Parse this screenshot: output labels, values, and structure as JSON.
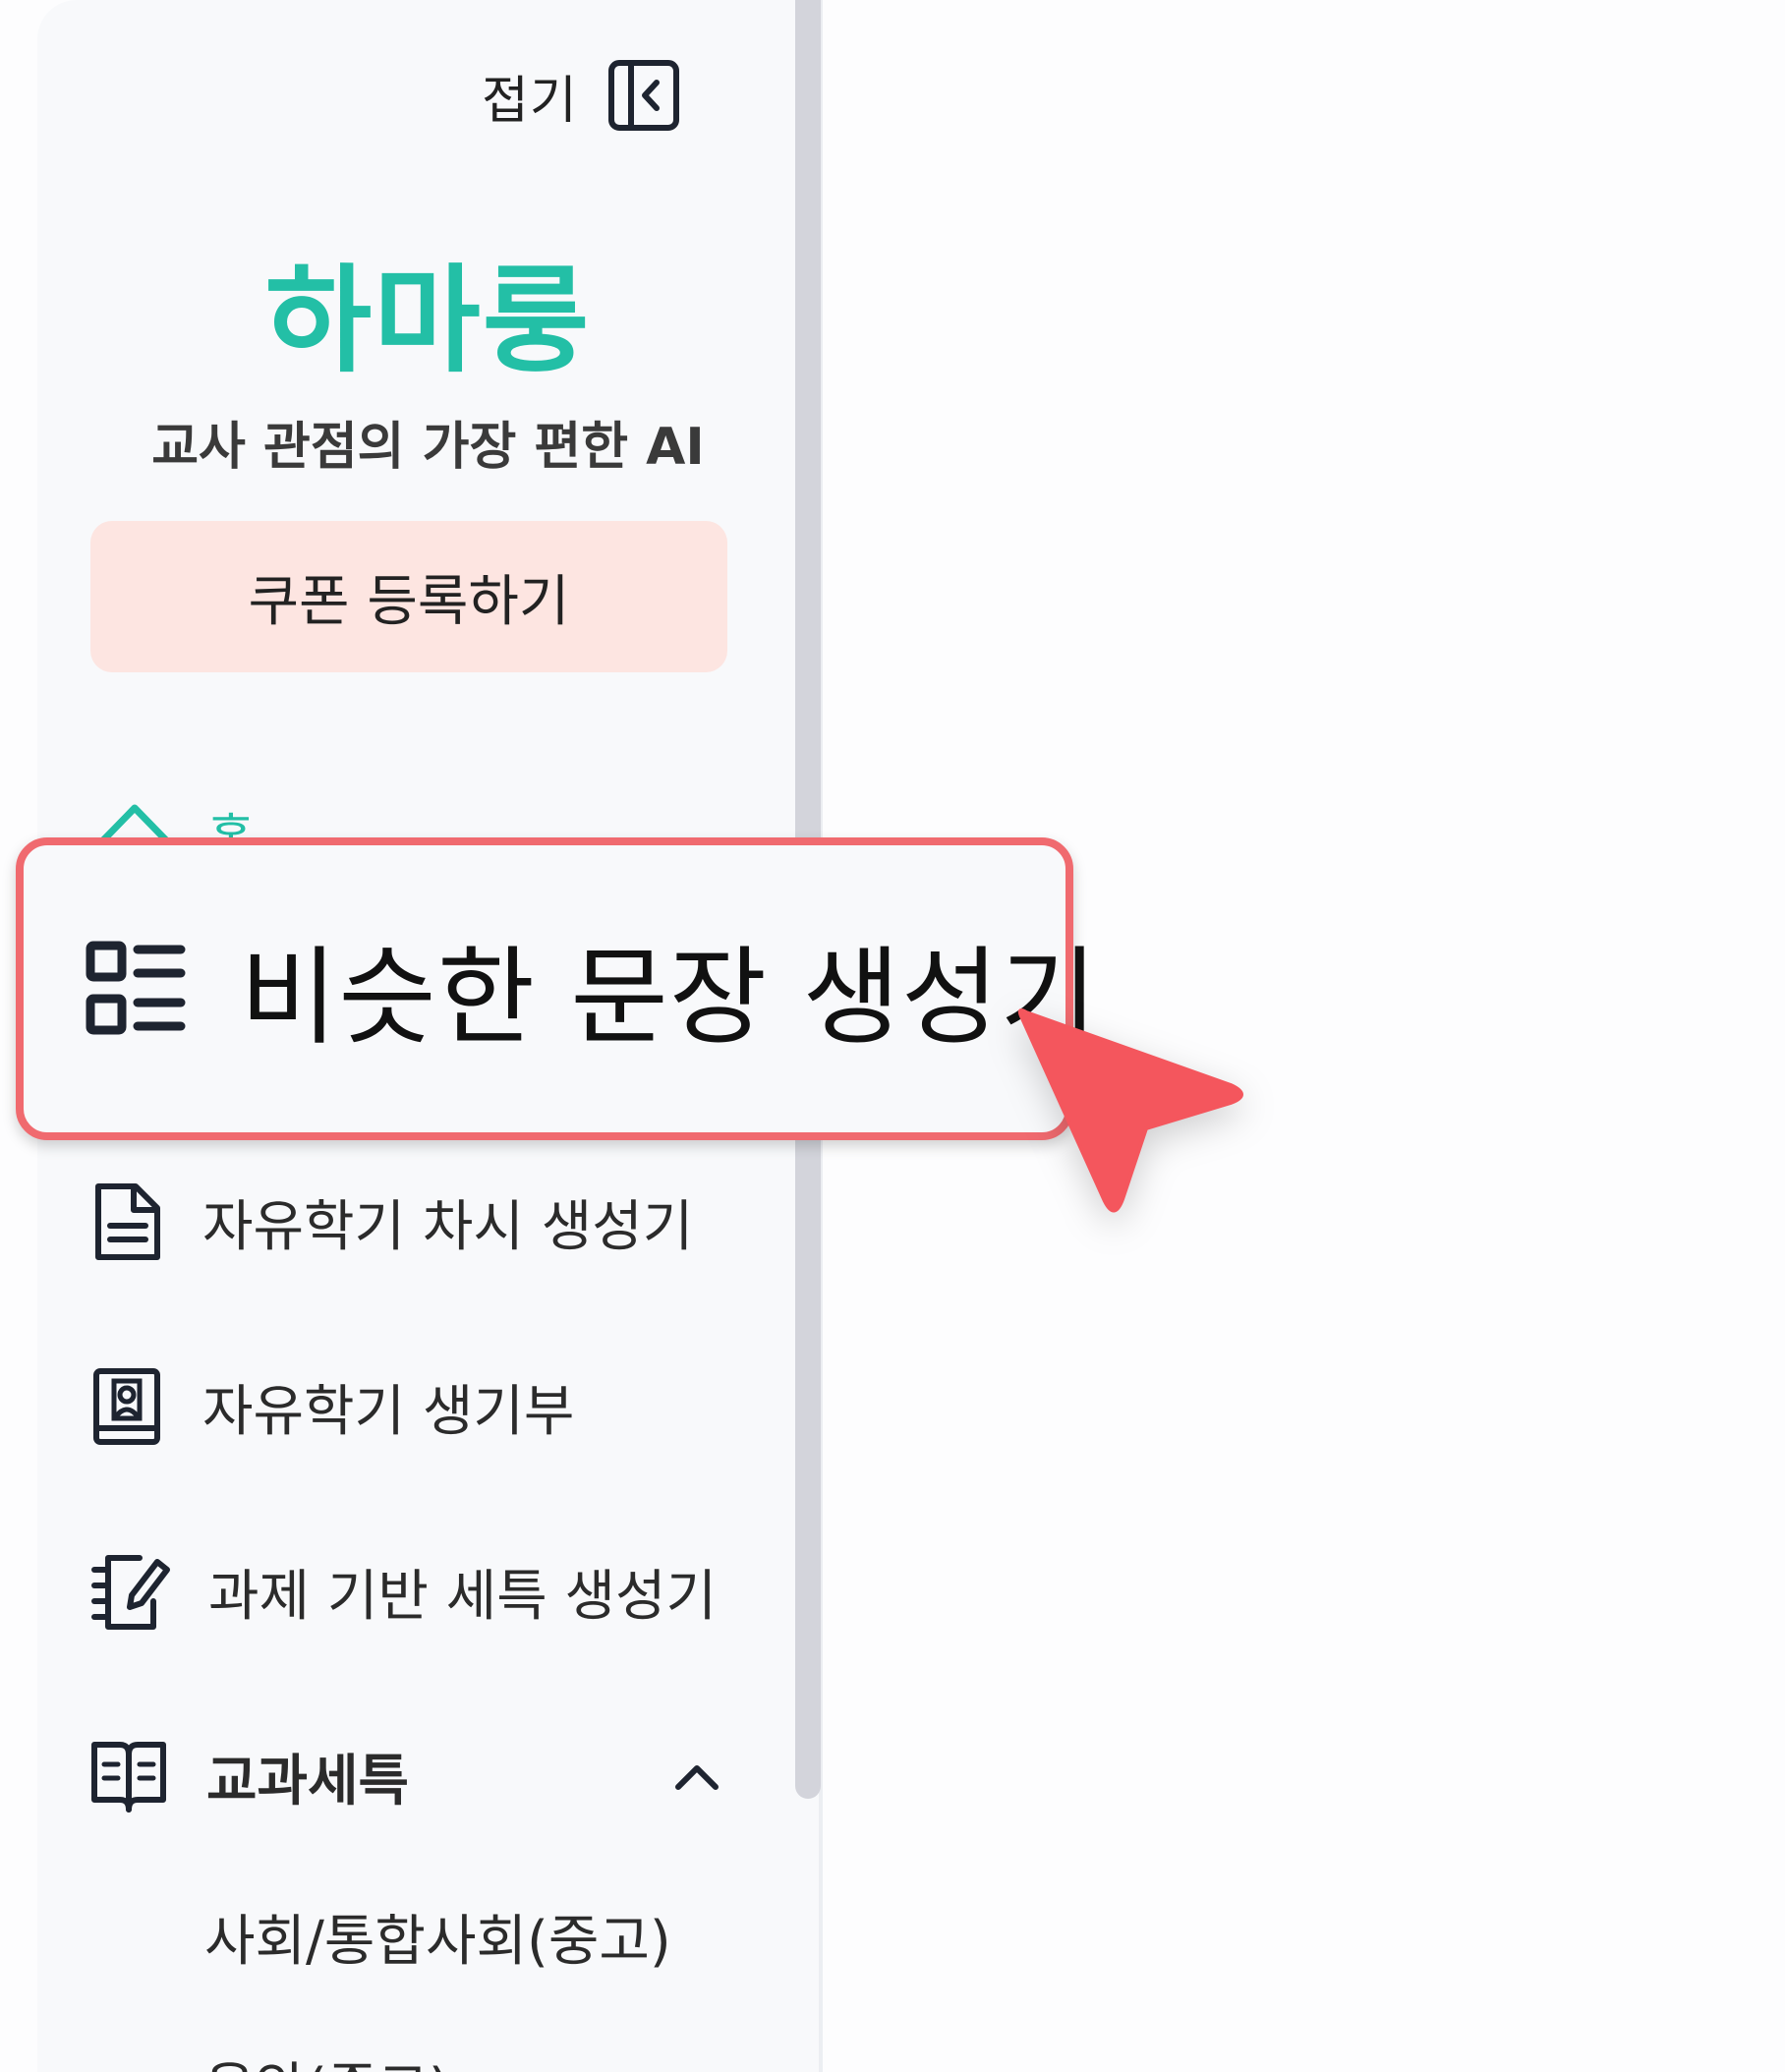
{
  "sidebar": {
    "collapse_label": "접기",
    "brand": "하마룽",
    "tagline": "교사 관점의 가장 편한 AI",
    "coupon_button": "쿠폰 등록하기",
    "home_label": "홈",
    "highlighted_item": {
      "label": "비슷한 문장 생성기",
      "icon": "list-icon"
    },
    "items": [
      {
        "label": "자유학기 차시 생성기",
        "icon": "document-icon"
      },
      {
        "label": "자유학기 생기부",
        "icon": "contact-book-icon"
      },
      {
        "label": "과제 기반 세특 생성기",
        "icon": "notebook-pen-icon"
      },
      {
        "label": "교과세특",
        "icon": "open-book-icon",
        "expanded": true
      }
    ],
    "sub_items": [
      "사회/통합사회(중고)",
      "음악(중고)"
    ]
  },
  "colors": {
    "brand": "#23bfa6",
    "coupon_bg": "#fde5e1",
    "highlight_border": "#f06a6f",
    "cursor": "#f4565d"
  }
}
